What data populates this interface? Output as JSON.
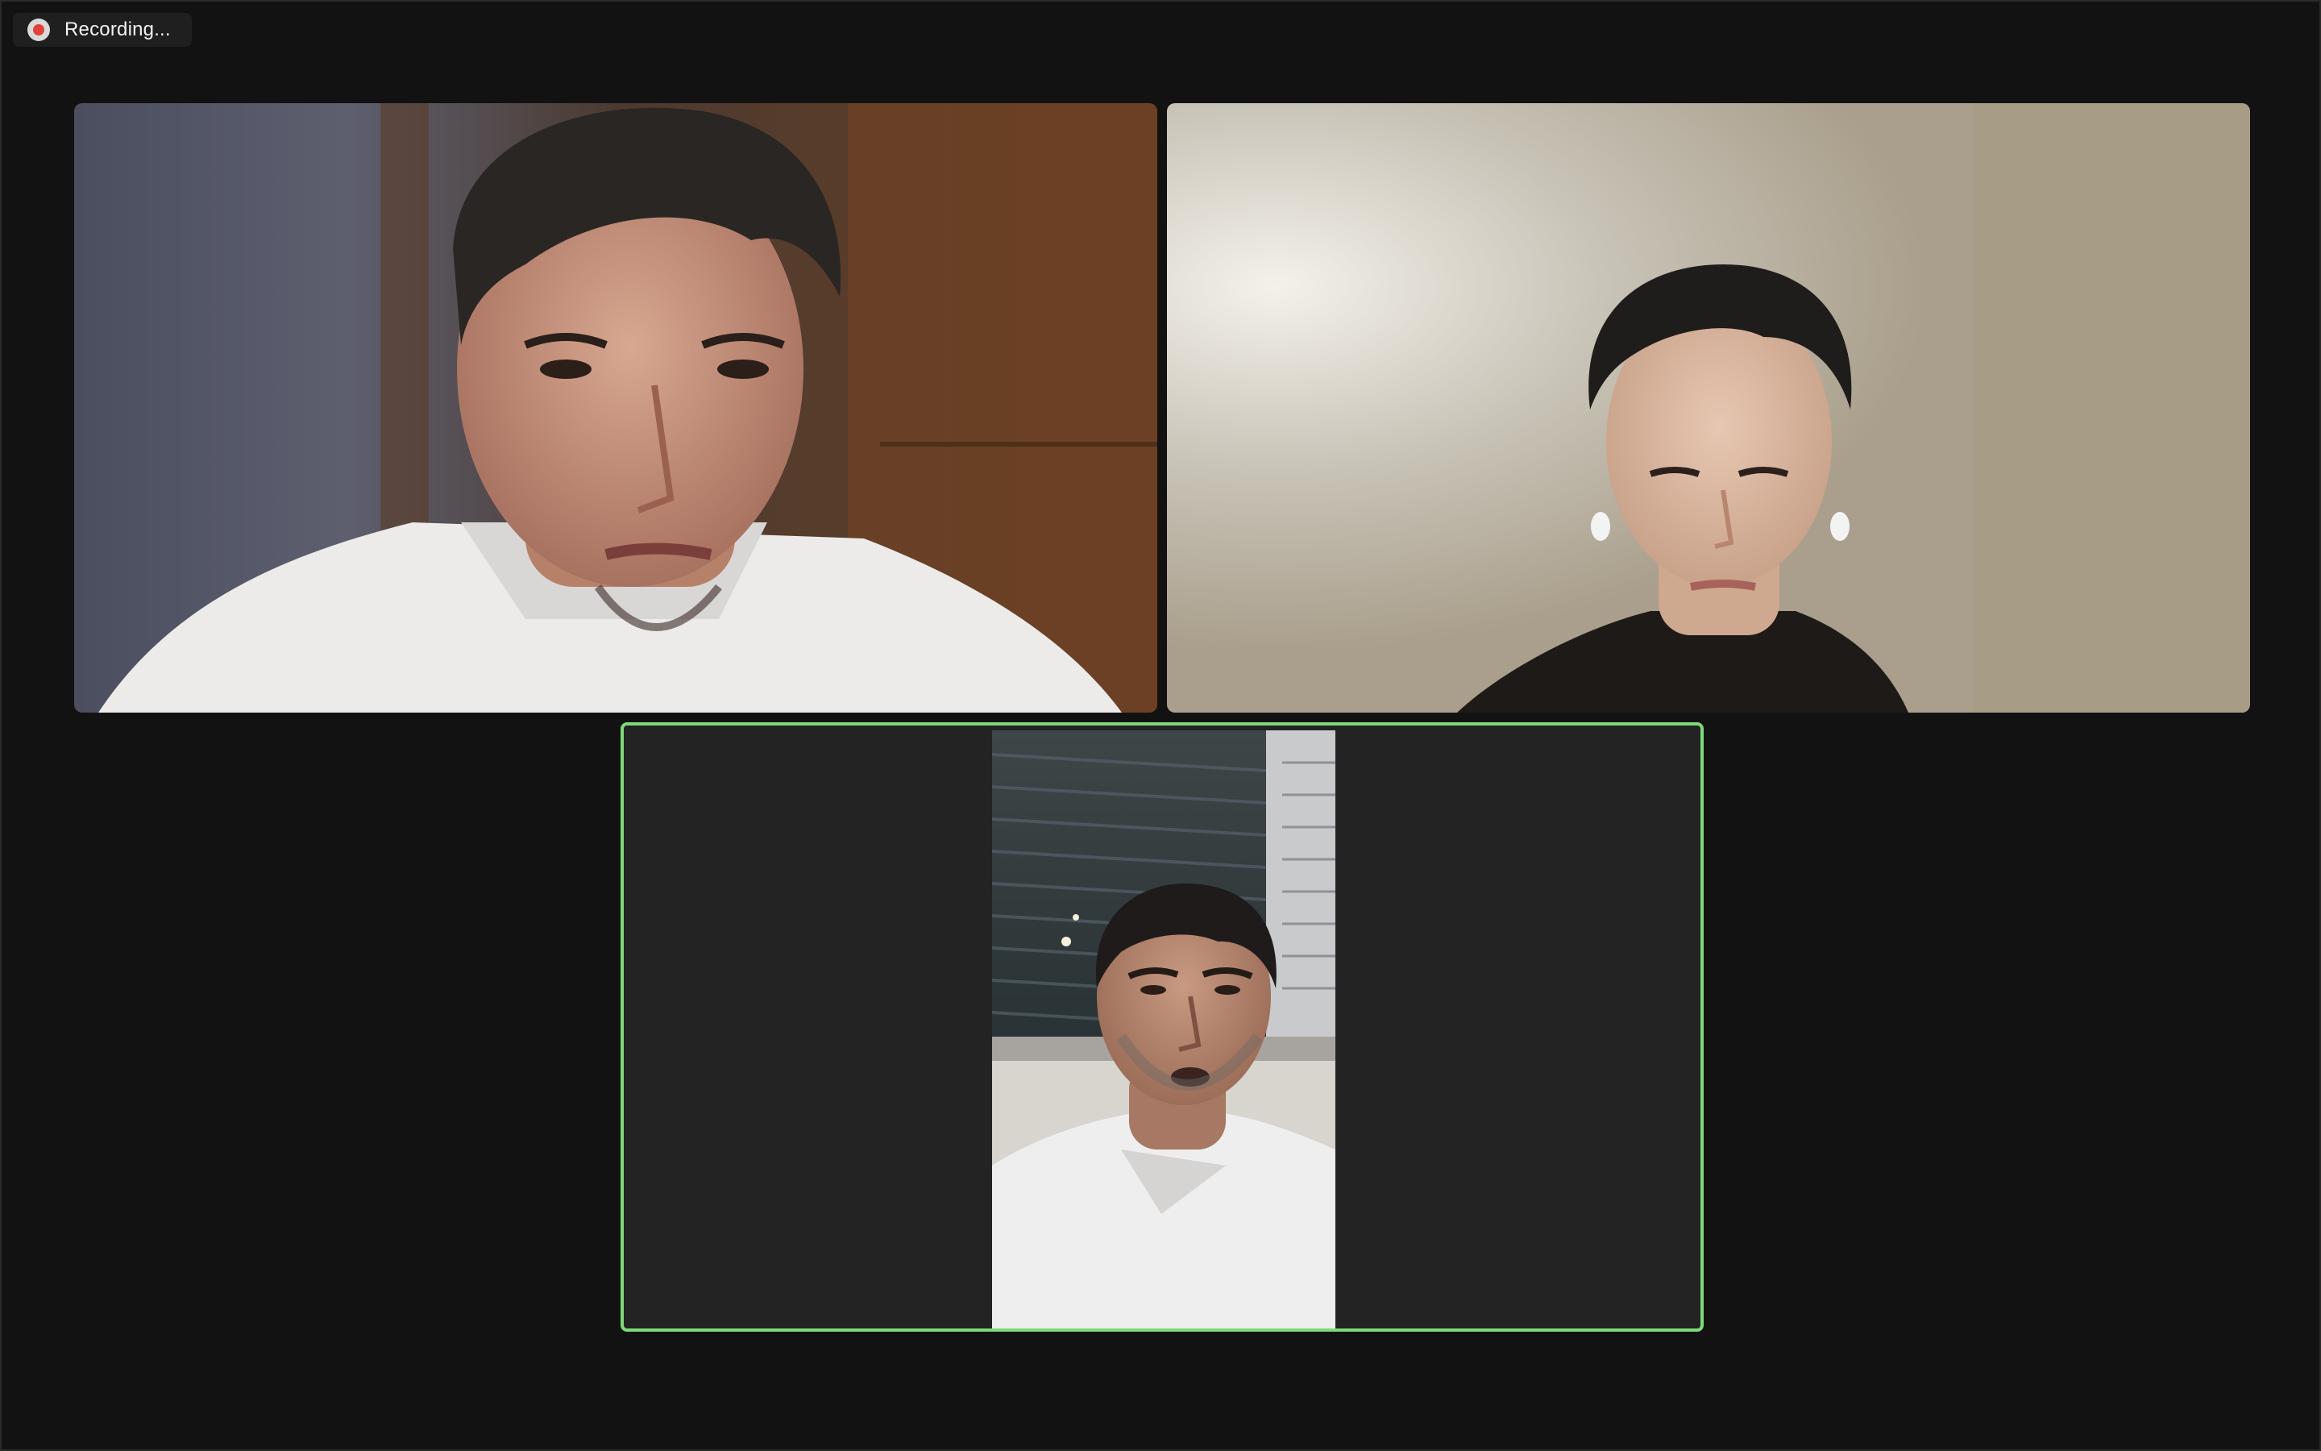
{
  "recording": {
    "label": "Recording...",
    "icon": "record-icon",
    "dot_color": "#e0413a"
  },
  "gallery": {
    "active_speaker_border": "#7ed97a",
    "participants": [
      {
        "tile": "participant-video-1"
      },
      {
        "tile": "participant-video-2"
      },
      {
        "tile": "participant-video-3",
        "active_speaker": true
      }
    ]
  }
}
